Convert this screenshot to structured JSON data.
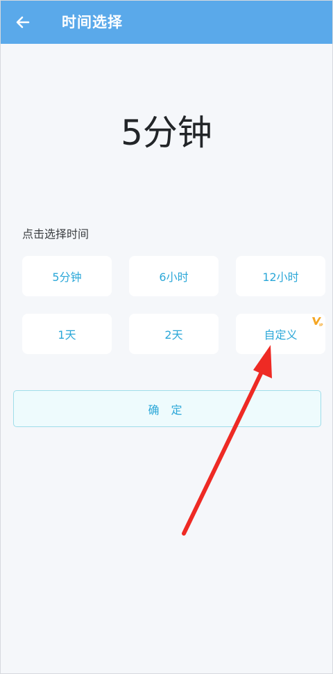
{
  "header": {
    "title": "时间选择",
    "back_icon": "arrow-left-icon",
    "background_color": "#5aa9ea"
  },
  "selected": {
    "display": "5分钟"
  },
  "options": {
    "hint": "点击选择时间",
    "items": [
      {
        "label": "5分钟"
      },
      {
        "label": "6小时"
      },
      {
        "label": "12小时"
      },
      {
        "label": "1天"
      },
      {
        "label": "2天"
      },
      {
        "label": "自定义",
        "badge": "VIP",
        "badge_color": "#f5a623"
      }
    ],
    "accent_color": "#2ba7d8"
  },
  "confirm": {
    "label": "确 定"
  },
  "annotation": {
    "arrow_color": "#ee2a24",
    "points_to": "自定义"
  }
}
